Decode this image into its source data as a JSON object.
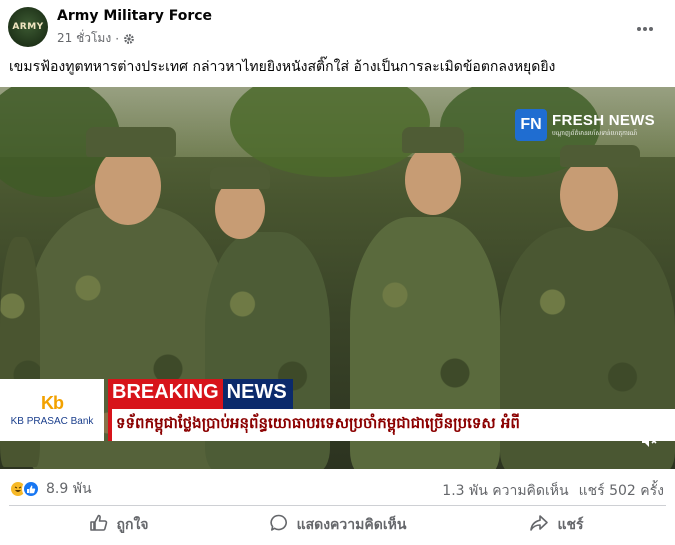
{
  "post": {
    "author": "Army Military Force",
    "avatar_text": "ARMY",
    "time": "21 ชั่วโมง",
    "separator": "·",
    "privacy_icon": "settings-gear-icon",
    "more_icon": "more-horizontal-icon",
    "caption": "เขมรฟ้องทูตทหารต่างประเทศ กล่าวหาไทยยิงหนังสติ๊กใส่ อ้างเป็นการละเมิดข้อตกลงหยุดยิง"
  },
  "media": {
    "watermark": {
      "logo_text": "FN",
      "title": "FRESH NEWS",
      "subtitle": "បណ្ដាញព័ត៌មានរហ័សទាន់ហេតុការណ៍"
    },
    "bank": {
      "logo": "Kb",
      "name": "KB PRASAC Bank"
    },
    "breaking_part1": "BREAKING",
    "breaking_part2": "NEWS",
    "ticker": "ទទ័ពកម្ពុជាថ្លែងប្រាប់អនុព័ន្ធយោធាបរទេសប្រចាំកម្ពុជាជាច្រើនប្រទេស អំពី",
    "volume_icon": "volume-muted-icon"
  },
  "engagement": {
    "reaction_icons": [
      "haha-reaction-icon",
      "like-reaction-icon"
    ],
    "reaction_count": "8.9 พัน",
    "comments": "1.3 พัน ความคิดเห็น",
    "shares": "แชร์ 502 ครั้ง"
  },
  "actions": {
    "like": "ถูกใจ",
    "comment": "แสดงความคิดเห็น",
    "share": "แชร์"
  },
  "colors": {
    "facebook_blue": "#1877f2",
    "breaking_red": "#d7141a",
    "breaking_navy": "#0b2a6b",
    "meta_gray": "#65676b"
  }
}
